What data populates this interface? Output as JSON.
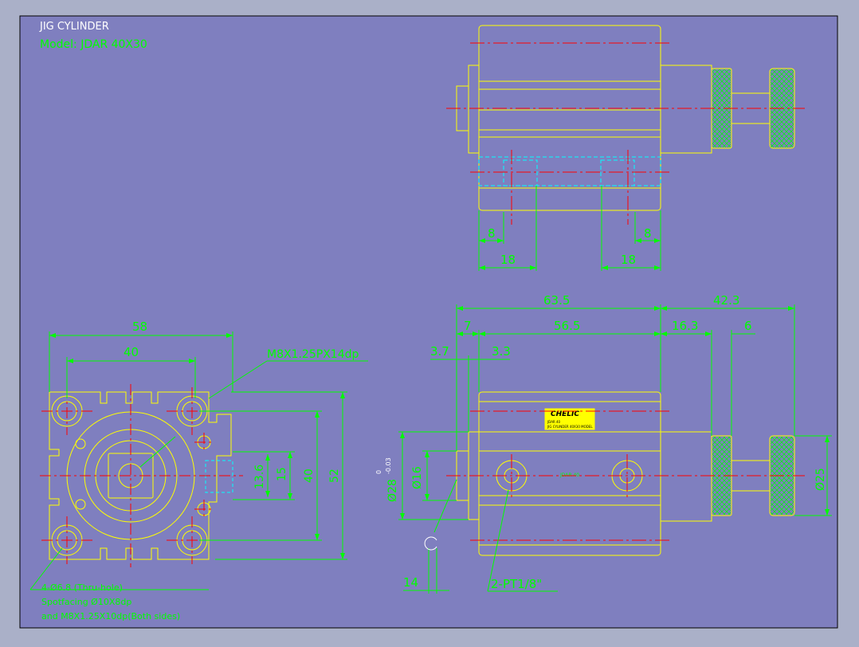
{
  "title": {
    "line1": "JIG  CYLINDER",
    "line2": "Model:  JDAR  40X30"
  },
  "top_view": {
    "dims": [
      "8",
      "18",
      "18",
      "8"
    ]
  },
  "left_view": {
    "dims": {
      "width_outer": "58",
      "width_inner": "40",
      "h_13_6": "13.6",
      "h_15": "15",
      "h_40": "40",
      "h_52": "52"
    },
    "callout_thread": "M8X1.25PX14dp",
    "note_lines": [
      "4-Ø6.8 (Thru-hole)",
      "Spotfacing  Ø10X8dp",
      "and M8X1.25X10dp(Both sides)"
    ]
  },
  "right_view": {
    "dims": {
      "total": "63.5",
      "right": "42.3",
      "d7": "7",
      "d56_5": "56.5",
      "d16_3": "16.3",
      "d6": "6",
      "d3_7": "3.7",
      "d3_3": "3.3",
      "d14": "14",
      "dia16": "Ø16",
      "dia28": "Ø28",
      "tol_up": "0",
      "tol_down": "-0.03",
      "dia25": "Ø25"
    },
    "port_callout": "2-PT1/8\"",
    "brand": "CHELIC",
    "badge_small": "JDAR 40",
    "plate_line1": "JDAR 40",
    "plate_line2": "JIG CYLINDER  40X30 MODEL"
  },
  "colors": {
    "background": "#7f7fbf",
    "outline": "#ffff00",
    "dimension": "#00ff00",
    "center": "#ff0000",
    "hidden": "#00ffff",
    "text": "#ffffff"
  }
}
